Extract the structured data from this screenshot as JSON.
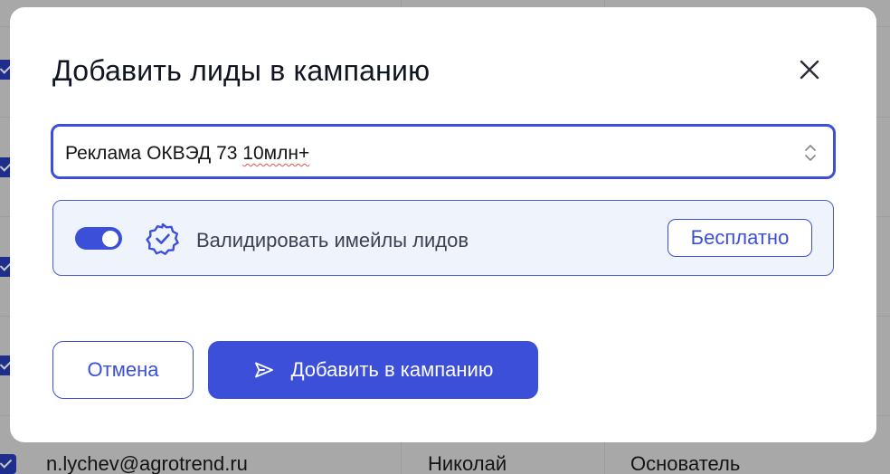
{
  "background": {
    "rows": [
      {
        "email": "",
        "name": "",
        "position": ""
      },
      {
        "email": "",
        "name": "",
        "position": ""
      },
      {
        "email": "",
        "name": "",
        "position": ""
      },
      {
        "email": "",
        "name": "",
        "position": ""
      },
      {
        "email": "n.lychev@agrotrend.ru",
        "name": "Николай",
        "position": "Основатель"
      }
    ]
  },
  "modal": {
    "title": "Добавить лиды в кампанию",
    "campaign_select": {
      "value_prefix": "Реклама ОКВЭД 73 ",
      "value_flagged": "10млн+"
    },
    "validation": {
      "enabled": true,
      "label": "Валидировать имейлы лидов",
      "badge": "Бесплатно"
    },
    "buttons": {
      "cancel": "Отмена",
      "submit": "Добавить в кампанию"
    }
  },
  "colors": {
    "accent": "#3b4fd9",
    "overlay": "#a8a8a8",
    "panel_bg": "#eff3fc"
  },
  "icons": {
    "close": "close-icon",
    "select_arrows": "chevron-up-down-icon",
    "verified": "verified-badge-icon",
    "send": "send-icon"
  }
}
